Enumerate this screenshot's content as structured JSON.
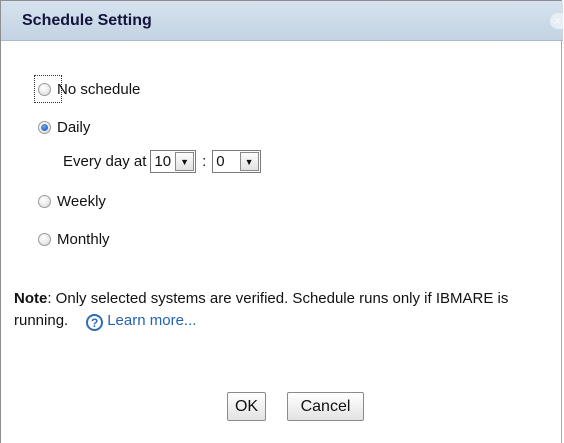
{
  "dialog": {
    "title": "Schedule Setting",
    "close_icon": "close-icon"
  },
  "schedule": {
    "options": [
      {
        "label": "No schedule",
        "checked": false
      },
      {
        "label": "Daily",
        "checked": true
      },
      {
        "label": "Weekly",
        "checked": false
      },
      {
        "label": "Monthly",
        "checked": false
      }
    ],
    "daily": {
      "prefix": "Every day at",
      "hour": "10",
      "separator": ":",
      "minute": "0"
    }
  },
  "note": {
    "label": "Note",
    "text": ": Only selected systems are verified. Schedule runs only if IBMARE is running.",
    "help_icon": "help-icon",
    "link": "Learn more..."
  },
  "buttons": {
    "ok": "OK",
    "cancel": "Cancel"
  },
  "colors": {
    "titlebar": "#c9d8e8",
    "radio_checked": "#2a66c7",
    "link": "#2462b3"
  }
}
